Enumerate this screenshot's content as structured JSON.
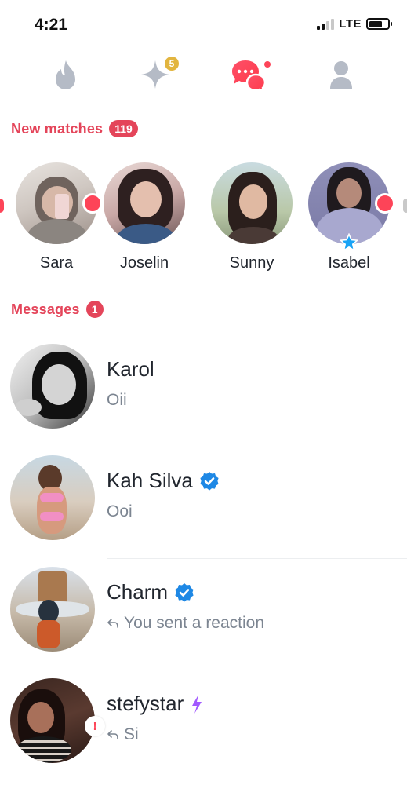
{
  "status_bar": {
    "time": "4:21",
    "network": "LTE",
    "signal_bars_filled": 2,
    "signal_bars_total": 4
  },
  "top_nav": {
    "items": [
      {
        "icon": "flame-icon",
        "active": false
      },
      {
        "icon": "sparkle-icon",
        "badge": "5",
        "active": false
      },
      {
        "icon": "chat-bubbles-icon",
        "active": true,
        "notification_dot": true
      },
      {
        "icon": "profile-icon",
        "active": false
      }
    ]
  },
  "new_matches": {
    "title": "New matches",
    "count": "119",
    "items": [
      {
        "name": "Sara",
        "new": true
      },
      {
        "name": "Joselin",
        "new": false
      },
      {
        "name": "Sunny",
        "new": false
      },
      {
        "name": "Isabel",
        "new": true,
        "super_like": true
      }
    ]
  },
  "messages": {
    "title": "Messages",
    "count": "1",
    "items": [
      {
        "name": "Karol",
        "preview": "Oii",
        "verified": false,
        "replied_reaction": false
      },
      {
        "name": "Kah Silva",
        "preview": "Ooi",
        "verified": true,
        "replied_reaction": false
      },
      {
        "name": "Charm",
        "preview": "You sent a reaction",
        "verified": true,
        "replied_reaction": true
      },
      {
        "name": "stefystar",
        "preview": "Si",
        "verified": false,
        "boost": true,
        "replied_reaction": true,
        "alert": "!"
      }
    ]
  },
  "colors": {
    "accent": "#e4455a",
    "dot": "#fd4458",
    "verified": "#1e88e5",
    "boost": "#a259ff",
    "badge_gold": "#e2b53f",
    "muted_icon": "#b5bbc6",
    "preview_text": "#7c8591"
  }
}
